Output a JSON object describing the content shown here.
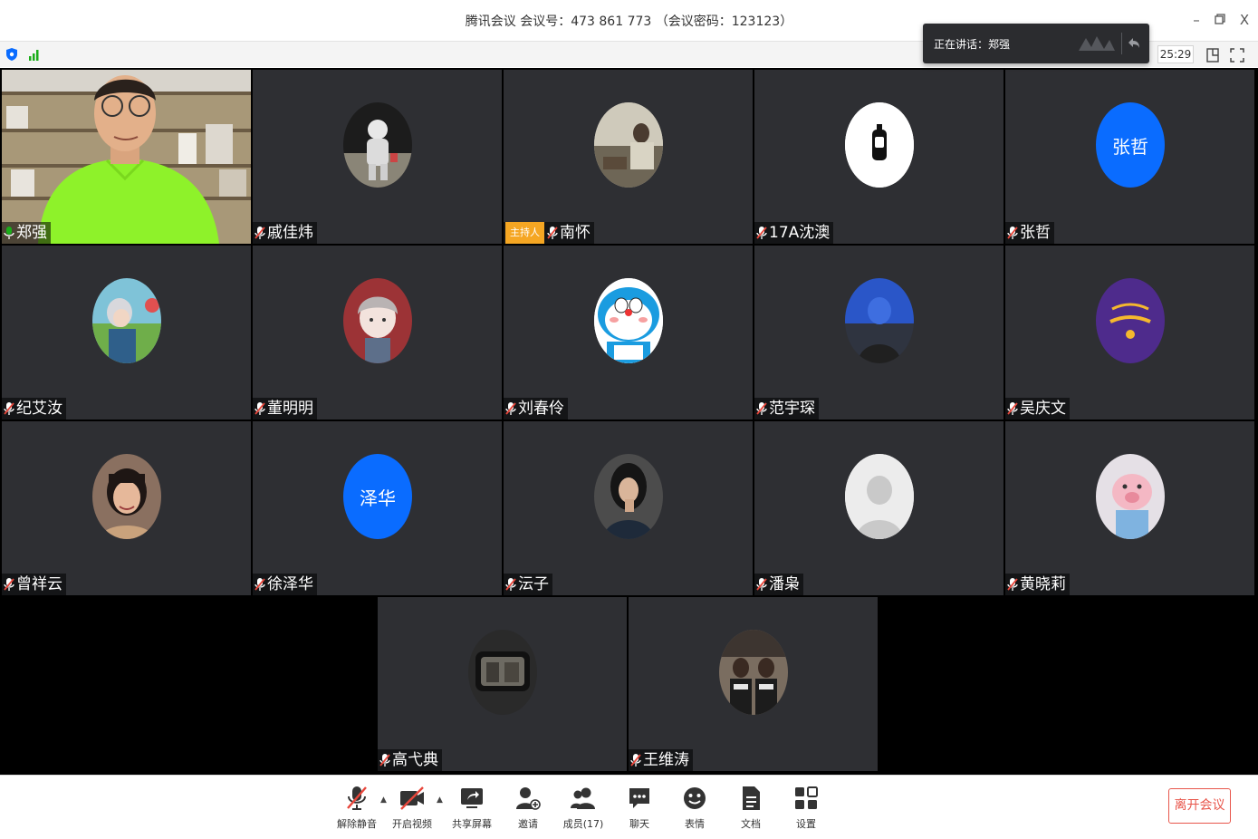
{
  "window": {
    "title": "腾讯会议 会议号：473 861 773 （会议密码：123123）",
    "minimize": "–",
    "restore": "▫",
    "close": "X"
  },
  "status": {
    "timer": "25:29"
  },
  "speaking": {
    "text": "正在讲话：郑强"
  },
  "participants": [
    {
      "name": "郑强",
      "mic": "active",
      "video": true
    },
    {
      "name": "戚佳炜",
      "mic": "muted"
    },
    {
      "name": "南怀",
      "mic": "muted",
      "host_label": "主持人"
    },
    {
      "name": "17A沈澳",
      "mic": "muted"
    },
    {
      "name": "张哲",
      "mic": "muted",
      "avatar_text": "张哲",
      "avatar_color": "#0a6cff"
    },
    {
      "name": "纪艾汝",
      "mic": "muted"
    },
    {
      "name": "董明明",
      "mic": "muted"
    },
    {
      "name": "刘春伶",
      "mic": "muted"
    },
    {
      "name": "范宇琛",
      "mic": "muted"
    },
    {
      "name": "吴庆文",
      "mic": "muted"
    },
    {
      "name": "曾祥云",
      "mic": "muted"
    },
    {
      "name": "徐泽华",
      "mic": "muted",
      "avatar_text": "泽华",
      "avatar_color": "#0a6cff"
    },
    {
      "name": "沄子",
      "mic": "muted"
    },
    {
      "name": "潘枭",
      "mic": "muted"
    },
    {
      "name": "黄晓莉",
      "mic": "muted"
    },
    {
      "name": "高弋典",
      "mic": "muted"
    },
    {
      "name": "王维涛",
      "mic": "muted"
    }
  ],
  "toolbar": {
    "unmute": "解除静音",
    "start_video": "开启视频",
    "share_screen": "共享屏幕",
    "invite": "邀请",
    "members": "成员(17)",
    "chat": "聊天",
    "reactions": "表情",
    "docs": "文档",
    "settings": "设置",
    "leave": "离开会议"
  },
  "colors": {
    "accent": "#0a6cff",
    "host_badge": "#f5a623",
    "leave": "#e8564b",
    "tile_bg": "#2e2f33",
    "signal": "#1aad19"
  }
}
